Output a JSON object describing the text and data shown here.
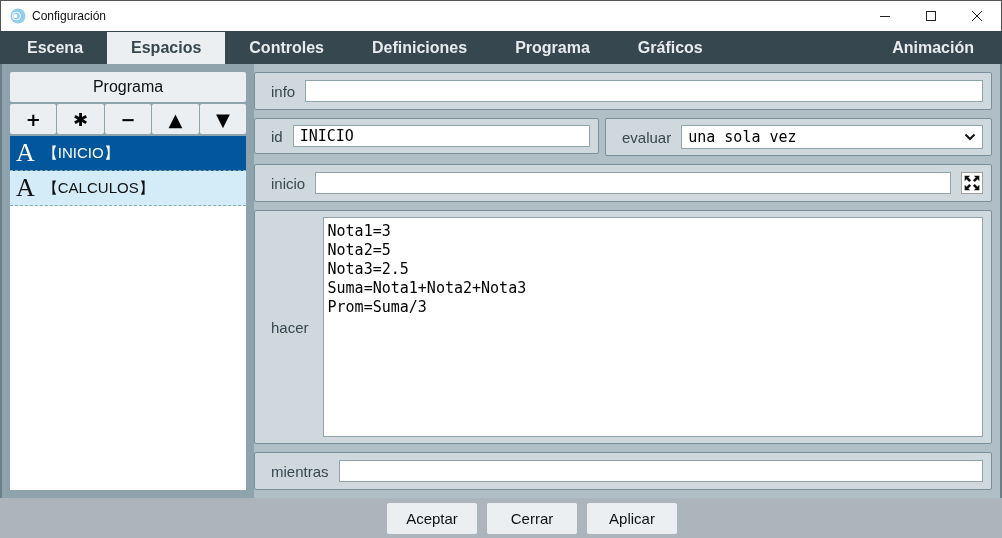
{
  "window": {
    "title": "Configuración"
  },
  "tabs": [
    {
      "label": "Escena",
      "selected": false
    },
    {
      "label": "Espacios",
      "selected": true
    },
    {
      "label": "Controles",
      "selected": false
    },
    {
      "label": "Definiciones",
      "selected": false
    },
    {
      "label": "Programa",
      "selected": false
    },
    {
      "label": "Gráficos",
      "selected": false
    },
    {
      "label": "Animación",
      "selected": false
    }
  ],
  "sidebar": {
    "title": "Programa",
    "tools": [
      "+",
      "✱",
      "−",
      "▲",
      "▼"
    ],
    "items": [
      {
        "icon": "A",
        "label": "【INICIO】",
        "selected": true
      },
      {
        "icon": "A",
        "label": "【CALCULOS】",
        "selected": false
      }
    ]
  },
  "form": {
    "info": {
      "label": "info"
    },
    "id": {
      "label": "id",
      "value": "INICIO"
    },
    "evaluar": {
      "label": "evaluar",
      "value": "una sola vez"
    },
    "inicio": {
      "label": "inicio"
    },
    "hacer": {
      "label": "hacer",
      "lines": [
        "Nota1=3",
        "Nota2=5",
        "Nota3=2.5",
        "Suma=Nota1+Nota2+Nota3",
        "Prom=Suma/3"
      ]
    },
    "mientras": {
      "label": "mientras"
    }
  },
  "buttons": [
    "Aceptar",
    "Cerrar",
    "Aplicar"
  ]
}
